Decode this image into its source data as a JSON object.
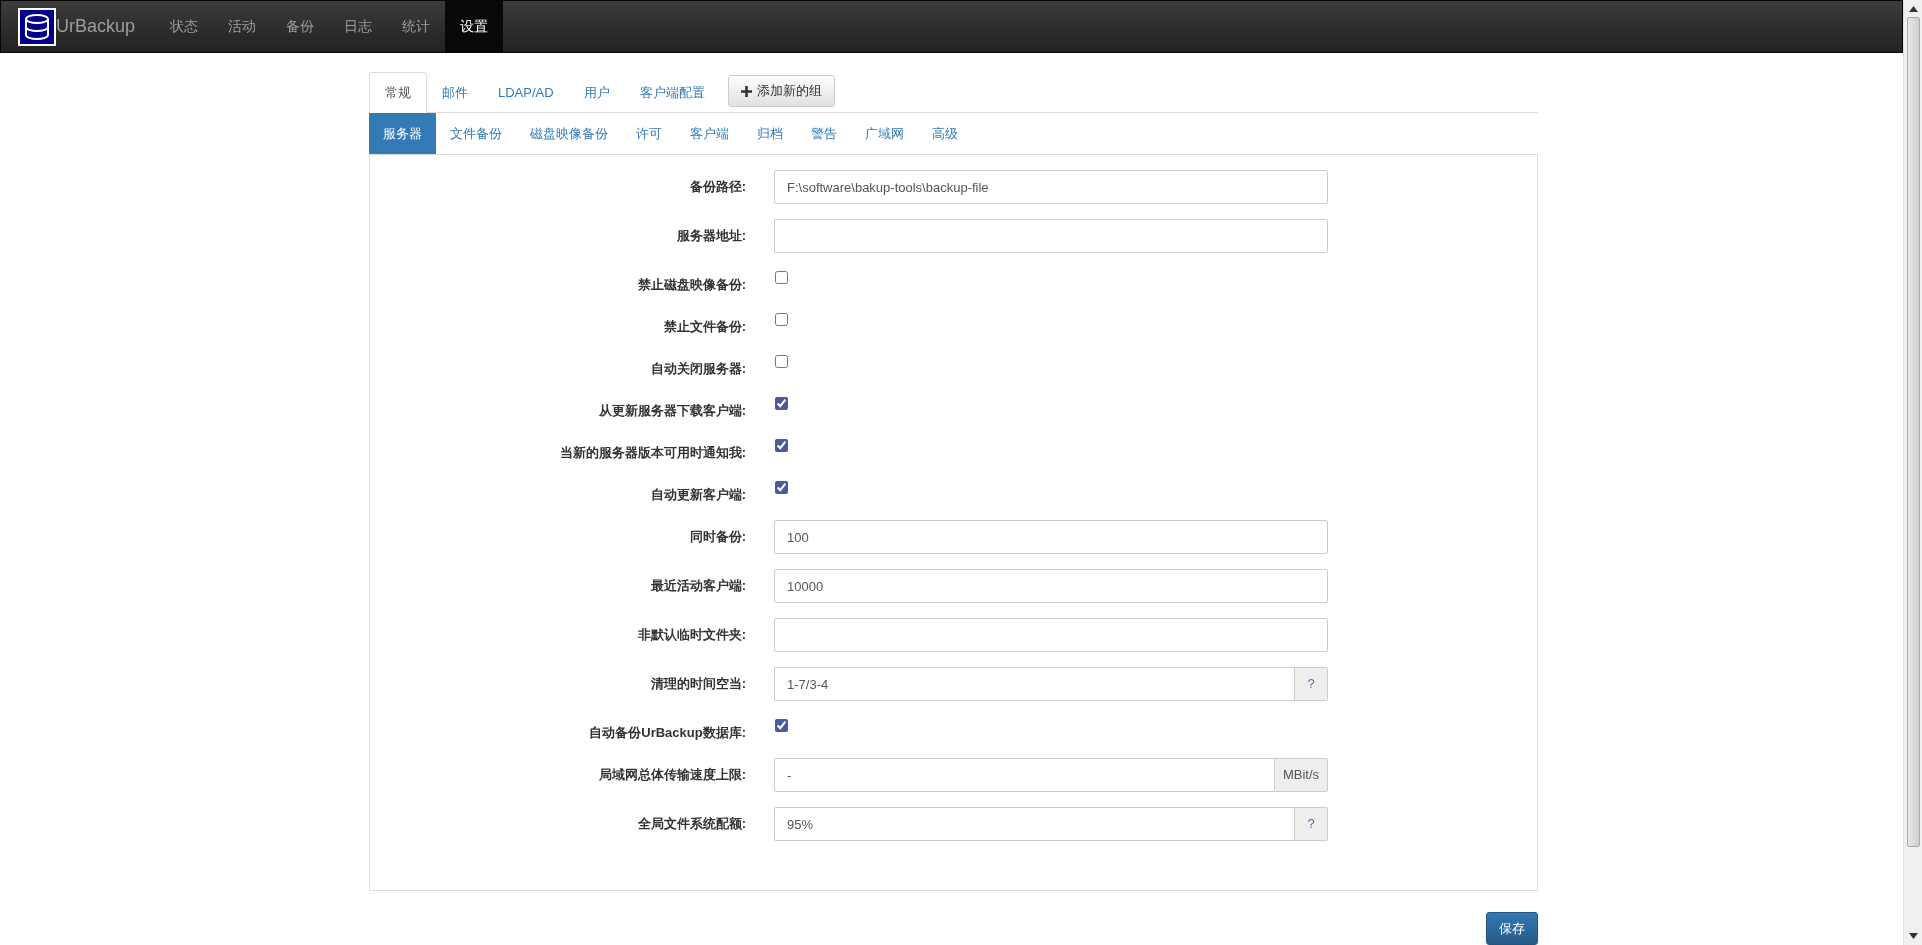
{
  "navbar": {
    "brand": "UrBackup",
    "items": [
      {
        "label": "状态",
        "selected": false
      },
      {
        "label": "活动",
        "selected": false
      },
      {
        "label": "备份",
        "selected": false
      },
      {
        "label": "日志",
        "selected": false
      },
      {
        "label": "统计",
        "selected": false
      },
      {
        "label": "设置",
        "selected": true
      }
    ]
  },
  "tabs": [
    {
      "label": "常规",
      "selected": true
    },
    {
      "label": "邮件",
      "selected": false
    },
    {
      "label": "LDAP/AD",
      "selected": false
    },
    {
      "label": "用户",
      "selected": false
    },
    {
      "label": "客户端配置",
      "selected": false
    }
  ],
  "add_group_button": "添加新的组",
  "subtabs": [
    {
      "label": "服务器",
      "selected": true
    },
    {
      "label": "文件备份",
      "selected": false
    },
    {
      "label": "磁盘映像备份",
      "selected": false
    },
    {
      "label": "许可",
      "selected": false
    },
    {
      "label": "客户端",
      "selected": false
    },
    {
      "label": "归档",
      "selected": false
    },
    {
      "label": "警告",
      "selected": false
    },
    {
      "label": "广域网",
      "selected": false
    },
    {
      "label": "高级",
      "selected": false
    }
  ],
  "form": [
    {
      "kind": "text",
      "label": "备份路径:",
      "value": "F:\\software\\bakup-tools\\backup-file"
    },
    {
      "kind": "text",
      "label": "服务器地址:"
    },
    {
      "kind": "checkbox",
      "label": "禁止磁盘映像备份:",
      "checked": false
    },
    {
      "kind": "checkbox",
      "label": "禁止文件备份:",
      "checked": false
    },
    {
      "kind": "checkbox",
      "label": "自动关闭服务器:",
      "checked": false
    },
    {
      "kind": "checkbox",
      "label": "从更新服务器下载客户端:",
      "checked": true
    },
    {
      "kind": "checkbox",
      "label": "当新的服务器版本可用时通知我:",
      "checked": true
    },
    {
      "kind": "checkbox",
      "label": "自动更新客户端:",
      "checked": true
    },
    {
      "kind": "text",
      "label": "同时备份:",
      "value": "100"
    },
    {
      "kind": "text",
      "label": "最近活动客户端:",
      "value": "10000"
    },
    {
      "kind": "text",
      "label": "非默认临时文件夹:"
    },
    {
      "kind": "text",
      "label": "清理的时间空当:",
      "value": "1-7/3-4",
      "addon": {
        "kind": "button",
        "text": "?"
      }
    },
    {
      "kind": "checkbox",
      "label": "自动备份UrBackup数据库:",
      "checked": true
    },
    {
      "kind": "text",
      "label": "局域网总体传输速度上限:",
      "value": "-",
      "addon": {
        "kind": "unit",
        "text": "MBit/s"
      }
    },
    {
      "kind": "text",
      "label": "全局文件系统配额:",
      "value": "95%",
      "addon": {
        "kind": "button",
        "text": "?"
      }
    }
  ],
  "save_button": "保存"
}
